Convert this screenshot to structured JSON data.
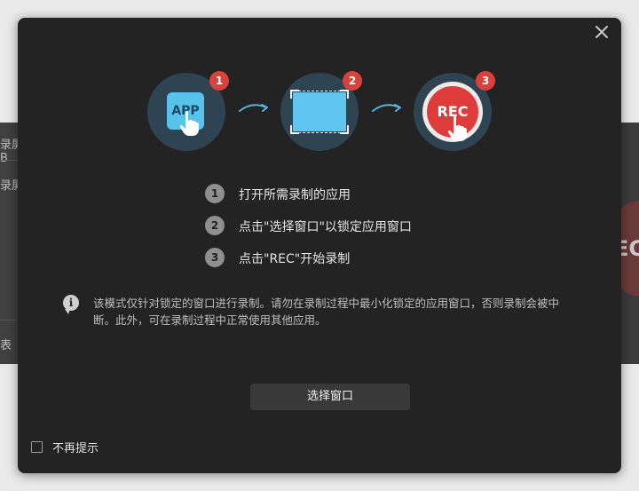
{
  "background_app": {
    "side_items": [
      "录屏B",
      "录屏",
      "表"
    ],
    "right_peek_text": "EC"
  },
  "modal": {
    "close_icon": "close-icon",
    "illustrations": [
      {
        "badge": "1",
        "tile_text": "APP",
        "icon": "app-tap-icon"
      },
      {
        "badge": "2",
        "icon": "select-region-icon"
      },
      {
        "badge": "3",
        "button_text": "REC",
        "icon": "rec-button-icon"
      }
    ],
    "steps": [
      {
        "num": "1",
        "text": "打开所需录制的应用"
      },
      {
        "num": "2",
        "text": "点击\"选择窗口\"以锁定应用窗口"
      },
      {
        "num": "3",
        "text": "点击\"REC\"开始录制"
      }
    ],
    "info": {
      "icon": "info-bubble-icon",
      "text": "该模式仅针对锁定的窗口进行录制。请勿在录制过程中最小化锁定的应用窗口，否则录制会被中断。此外，可在录制过程中正常使用其他应用。"
    },
    "primary_button": "选择窗口",
    "dont_show_again": {
      "label": "不再提示",
      "checked": false
    }
  },
  "colors": {
    "modal_bg": "#232323",
    "accent_blue": "#58c2ea",
    "rec_red": "#de3b3b",
    "badge_red": "#d9423c"
  }
}
